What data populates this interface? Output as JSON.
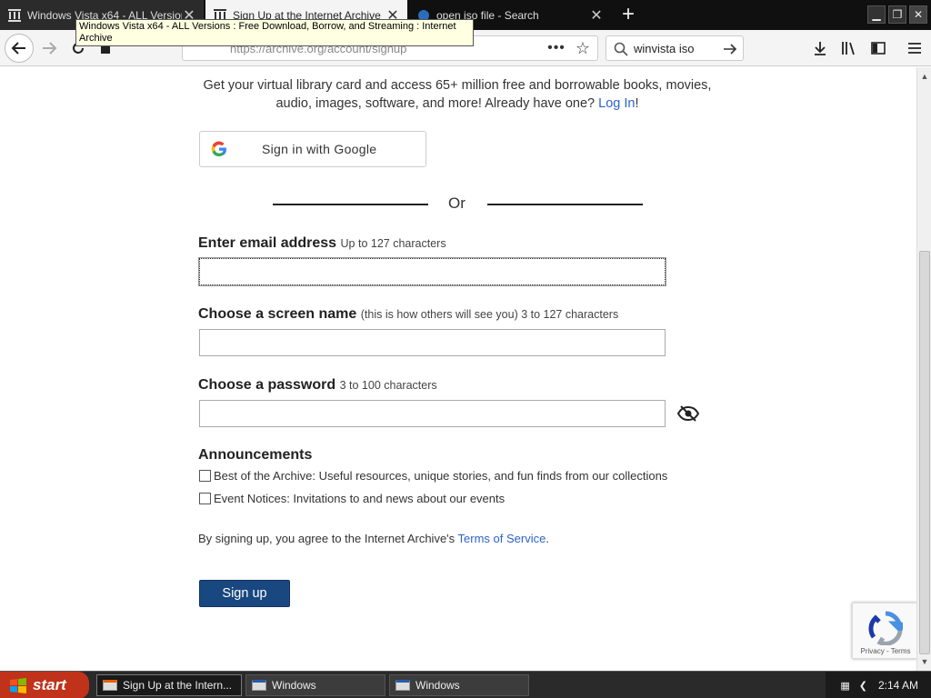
{
  "browser": {
    "tabs": [
      {
        "title": "Windows Vista x64 - ALL Versions",
        "active": false
      },
      {
        "title": "Sign Up at the Internet Archive",
        "active": true
      },
      {
        "title": "open iso file - Search",
        "active": false
      }
    ],
    "tooltip": "Windows Vista x64 - ALL Versions : Free Download, Borrow, and Streaming : Internet Archive",
    "url": "https://archive.org/account/signup",
    "search_value": "winvista iso"
  },
  "page": {
    "intro_text": "Get your virtual library card and access 65+ million free and borrowable books, movies, audio, images, software, and more! Already have one?",
    "login_link": "Log In",
    "login_suffix": "!",
    "google_button": "Sign in with Google",
    "or_text": "Or",
    "email": {
      "label": "Enter email address",
      "hint": "Up to 127 characters",
      "value": ""
    },
    "screen_name": {
      "label": "Choose a screen name",
      "hint": "(this is how others will see you) 3 to 127 characters",
      "value": ""
    },
    "password": {
      "label": "Choose a password",
      "hint": "3 to 100 characters",
      "value": ""
    },
    "announcements": {
      "title": "Announcements",
      "options": [
        {
          "label": "Best of the Archive: Useful resources, unique stories, and fun finds from our collections",
          "checked": false
        },
        {
          "label": "Event Notices: Invitations to and news about our events",
          "checked": false
        }
      ]
    },
    "terms_prefix": "By signing up, you agree to the Internet Archive's",
    "terms_link": "Terms of Service",
    "terms_suffix": ".",
    "signup_button": "Sign up",
    "recaptcha_links": "Privacy - Terms"
  },
  "taskbar": {
    "start_label": "start",
    "tasks": [
      {
        "label": "Sign Up at the Intern...",
        "active": true
      },
      {
        "label": "Windows",
        "active": false
      },
      {
        "label": "Windows",
        "active": false
      }
    ],
    "clock": "2:14 AM"
  }
}
